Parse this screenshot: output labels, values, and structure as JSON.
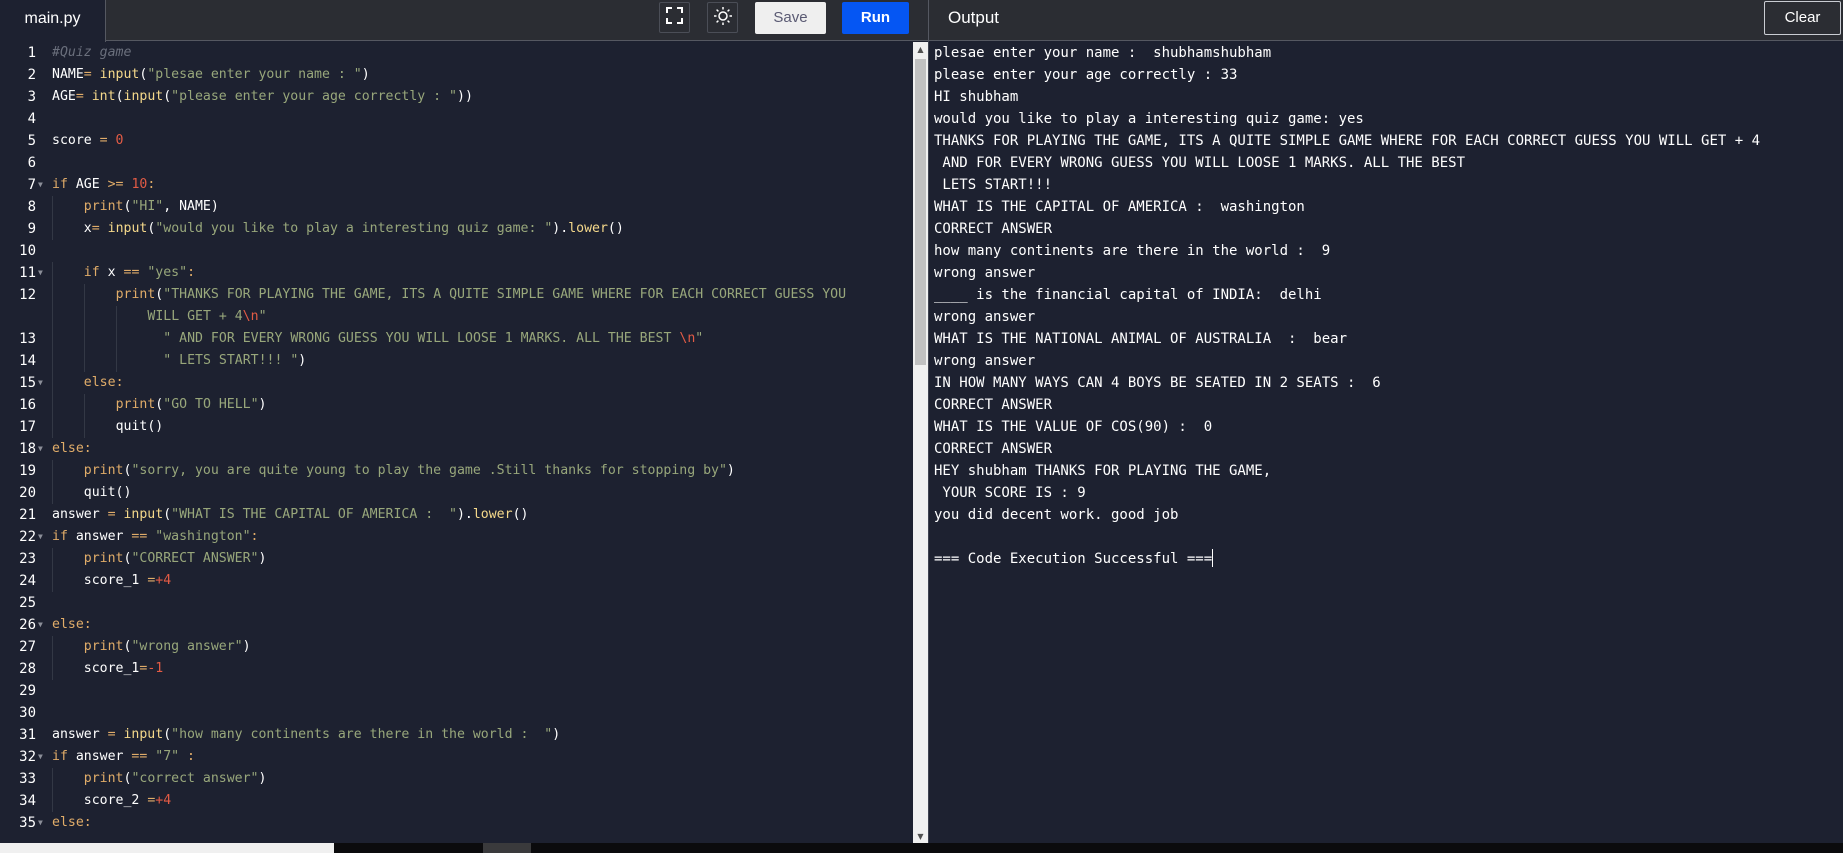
{
  "header": {
    "file_tab": "main.py",
    "fullscreen_icon": "fullscreen-icon",
    "theme_icon": "sun-icon",
    "save_label": "Save",
    "run_label": "Run",
    "output_title": "Output",
    "clear_label": "Clear"
  },
  "colors": {
    "run_button": "#0556f3",
    "editor_bg": "#1d2130",
    "header_bg": "#2b2d33",
    "keyword": "#e0ac69",
    "string": "#98a77b",
    "number": "#e25b45"
  },
  "editor": {
    "lines": [
      {
        "n": "1",
        "fold": false,
        "indent": 0,
        "tokens": [
          [
            "cmt",
            "#Quiz game"
          ]
        ]
      },
      {
        "n": "2",
        "fold": false,
        "indent": 0,
        "tokens": [
          [
            "",
            "NAME"
          ],
          [
            "op",
            "="
          ],
          [
            "",
            " "
          ],
          [
            "fn",
            "input"
          ],
          [
            "",
            "("
          ],
          [
            "str",
            "\"plesae enter your name : \""
          ],
          [
            "",
            ")"
          ]
        ]
      },
      {
        "n": "3",
        "fold": false,
        "indent": 0,
        "tokens": [
          [
            "",
            "AGE"
          ],
          [
            "op",
            "="
          ],
          [
            "",
            " "
          ],
          [
            "fn",
            "int"
          ],
          [
            "",
            "("
          ],
          [
            "fn",
            "input"
          ],
          [
            "",
            "("
          ],
          [
            "str",
            "\"please enter your age correctly : \""
          ],
          [
            "",
            "))"
          ]
        ]
      },
      {
        "n": "4",
        "fold": false,
        "indent": 0,
        "tokens": []
      },
      {
        "n": "5",
        "fold": false,
        "indent": 0,
        "tokens": [
          [
            "",
            "score "
          ],
          [
            "op",
            "="
          ],
          [
            "",
            " "
          ],
          [
            "num",
            "0"
          ]
        ]
      },
      {
        "n": "6",
        "fold": false,
        "indent": 0,
        "tokens": []
      },
      {
        "n": "7",
        "fold": true,
        "indent": 0,
        "tokens": [
          [
            "kw",
            "if"
          ],
          [
            "",
            " AGE "
          ],
          [
            "op",
            ">="
          ],
          [
            "",
            " "
          ],
          [
            "num",
            "10"
          ],
          [
            "op",
            ":"
          ]
        ]
      },
      {
        "n": "8",
        "fold": false,
        "indent": 1,
        "tokens": [
          [
            "kw",
            "print"
          ],
          [
            "",
            "("
          ],
          [
            "str",
            "\"HI\""
          ],
          [
            "",
            ", NAME)"
          ]
        ]
      },
      {
        "n": "9",
        "fold": false,
        "indent": 1,
        "tokens": [
          [
            "",
            "x"
          ],
          [
            "op",
            "="
          ],
          [
            "",
            " "
          ],
          [
            "fn",
            "input"
          ],
          [
            "",
            "("
          ],
          [
            "str",
            "\"would you like to play a interesting quiz game: \""
          ],
          [
            "",
            ")."
          ],
          [
            "fn",
            "lower"
          ],
          [
            "",
            "()"
          ]
        ]
      },
      {
        "n": "10",
        "fold": false,
        "indent": 0,
        "tokens": []
      },
      {
        "n": "11",
        "fold": true,
        "indent": 1,
        "tokens": [
          [
            "kw",
            "if"
          ],
          [
            "",
            " x "
          ],
          [
            "op",
            "=="
          ],
          [
            "",
            " "
          ],
          [
            "str",
            "\"yes\""
          ],
          [
            "op",
            ":"
          ]
        ]
      },
      {
        "n": "12",
        "fold": false,
        "indent": 2,
        "tokens": [
          [
            "kw",
            "print"
          ],
          [
            "",
            "("
          ],
          [
            "str",
            "\"THANKS FOR PLAYING THE GAME, ITS A QUITE SIMPLE GAME WHERE FOR EACH CORRECT GUESS YOU"
          ]
        ]
      },
      {
        "n": "",
        "fold": false,
        "indent": 3,
        "tokens": [
          [
            "str",
            "WILL GET + 4"
          ],
          [
            "esc",
            "\\n"
          ],
          [
            "str",
            "\""
          ]
        ]
      },
      {
        "n": "13",
        "fold": false,
        "indent": 3.5,
        "tokens": [
          [
            "str",
            "\" AND FOR EVERY WRONG GUESS YOU WILL LOOSE 1 MARKS. ALL THE BEST "
          ],
          [
            "esc",
            "\\n"
          ],
          [
            "str",
            "\""
          ]
        ]
      },
      {
        "n": "14",
        "fold": false,
        "indent": 3.5,
        "tokens": [
          [
            "str",
            "\" LETS START!!! \""
          ],
          [
            "",
            ")"
          ]
        ]
      },
      {
        "n": "15",
        "fold": true,
        "indent": 1,
        "tokens": [
          [
            "kw",
            "else"
          ],
          [
            "op",
            ":"
          ]
        ]
      },
      {
        "n": "16",
        "fold": false,
        "indent": 2,
        "tokens": [
          [
            "kw",
            "print"
          ],
          [
            "",
            "("
          ],
          [
            "str",
            "\"GO TO HELL\""
          ],
          [
            "",
            ")"
          ]
        ]
      },
      {
        "n": "17",
        "fold": false,
        "indent": 2,
        "tokens": [
          [
            "",
            "quit()"
          ]
        ]
      },
      {
        "n": "18",
        "fold": true,
        "indent": 0,
        "tokens": [
          [
            "kw",
            "else"
          ],
          [
            "op",
            ":"
          ]
        ]
      },
      {
        "n": "19",
        "fold": false,
        "indent": 1,
        "tokens": [
          [
            "kw",
            "print"
          ],
          [
            "",
            "("
          ],
          [
            "str",
            "\"sorry, you are quite young to play the game .Still thanks for stopping by\""
          ],
          [
            "",
            ")"
          ]
        ]
      },
      {
        "n": "20",
        "fold": false,
        "indent": 1,
        "tokens": [
          [
            "",
            "quit()"
          ]
        ]
      },
      {
        "n": "21",
        "fold": false,
        "indent": 0,
        "tokens": [
          [
            "",
            "answer "
          ],
          [
            "op",
            "="
          ],
          [
            "",
            " "
          ],
          [
            "fn",
            "input"
          ],
          [
            "",
            "("
          ],
          [
            "str",
            "\"WHAT IS THE CAPITAL OF AMERICA :  \""
          ],
          [
            "",
            ")."
          ],
          [
            "fn",
            "lower"
          ],
          [
            "",
            "()"
          ]
        ]
      },
      {
        "n": "22",
        "fold": true,
        "indent": 0,
        "tokens": [
          [
            "kw",
            "if"
          ],
          [
            "",
            " answer "
          ],
          [
            "op",
            "=="
          ],
          [
            "",
            " "
          ],
          [
            "str",
            "\"washington\""
          ],
          [
            "op",
            ":"
          ]
        ]
      },
      {
        "n": "23",
        "fold": false,
        "indent": 1,
        "tokens": [
          [
            "kw",
            "print"
          ],
          [
            "",
            "("
          ],
          [
            "str",
            "\"CORRECT ANSWER\""
          ],
          [
            "",
            ")"
          ]
        ]
      },
      {
        "n": "24",
        "fold": false,
        "indent": 1,
        "tokens": [
          [
            "",
            "score_1 "
          ],
          [
            "op",
            "="
          ],
          [
            "num",
            "+4"
          ]
        ]
      },
      {
        "n": "25",
        "fold": false,
        "indent": 0,
        "tokens": []
      },
      {
        "n": "26",
        "fold": true,
        "indent": 0,
        "tokens": [
          [
            "kw",
            "else"
          ],
          [
            "op",
            ":"
          ]
        ]
      },
      {
        "n": "27",
        "fold": false,
        "indent": 1,
        "tokens": [
          [
            "kw",
            "print"
          ],
          [
            "",
            "("
          ],
          [
            "str",
            "\"wrong answer\""
          ],
          [
            "",
            ")"
          ]
        ]
      },
      {
        "n": "28",
        "fold": false,
        "indent": 1,
        "tokens": [
          [
            "",
            "score_1"
          ],
          [
            "op",
            "="
          ],
          [
            "num",
            "-1"
          ]
        ]
      },
      {
        "n": "29",
        "fold": false,
        "indent": 0,
        "tokens": []
      },
      {
        "n": "30",
        "fold": false,
        "indent": 0,
        "tokens": []
      },
      {
        "n": "31",
        "fold": false,
        "indent": 0,
        "tokens": [
          [
            "",
            "answer "
          ],
          [
            "op",
            "="
          ],
          [
            "",
            " "
          ],
          [
            "fn",
            "input"
          ],
          [
            "",
            "("
          ],
          [
            "str",
            "\"how many continents are there in the world :  \""
          ],
          [
            "",
            ")"
          ]
        ]
      },
      {
        "n": "32",
        "fold": true,
        "indent": 0,
        "tokens": [
          [
            "kw",
            "if"
          ],
          [
            "",
            " answer "
          ],
          [
            "op",
            "=="
          ],
          [
            "",
            " "
          ],
          [
            "str",
            "\"7\""
          ],
          [
            "",
            " "
          ],
          [
            "op",
            ":"
          ]
        ]
      },
      {
        "n": "33",
        "fold": false,
        "indent": 1,
        "tokens": [
          [
            "kw",
            "print"
          ],
          [
            "",
            "("
          ],
          [
            "str",
            "\"correct answer\""
          ],
          [
            "",
            ")"
          ]
        ]
      },
      {
        "n": "34",
        "fold": false,
        "indent": 1,
        "tokens": [
          [
            "",
            "score_2 "
          ],
          [
            "op",
            "="
          ],
          [
            "num",
            "+4"
          ]
        ]
      },
      {
        "n": "35",
        "fold": true,
        "indent": 0,
        "tokens": [
          [
            "kw",
            "else"
          ],
          [
            "op",
            ":"
          ]
        ]
      }
    ]
  },
  "output": {
    "lines": [
      "plesae enter your name :  shubhamshubham",
      "please enter your age correctly : 33",
      "HI shubham",
      "would you like to play a interesting quiz game: yes",
      "THANKS FOR PLAYING THE GAME, ITS A QUITE SIMPLE GAME WHERE FOR EACH CORRECT GUESS YOU WILL GET + 4",
      " AND FOR EVERY WRONG GUESS YOU WILL LOOSE 1 MARKS. ALL THE BEST",
      " LETS START!!!",
      "WHAT IS THE CAPITAL OF AMERICA :  washington",
      "CORRECT ANSWER",
      "how many continents are there in the world :  9",
      "wrong answer",
      "____ is the financial capital of INDIA:  delhi",
      "wrong answer",
      "WHAT IS THE NATIONAL ANIMAL OF AUSTRALIA  :  bear",
      "wrong answer",
      "IN HOW MANY WAYS CAN 4 BOYS BE SEATED IN 2 SEATS :  6",
      "CORRECT ANSWER",
      "WHAT IS THE VALUE OF COS(90) :  0",
      "CORRECT ANSWER",
      "HEY shubham THANKS FOR PLAYING THE GAME,",
      " YOUR SCORE IS : 9",
      "you did decent work. good job",
      "",
      "=== Code Execution Successful ==="
    ]
  }
}
